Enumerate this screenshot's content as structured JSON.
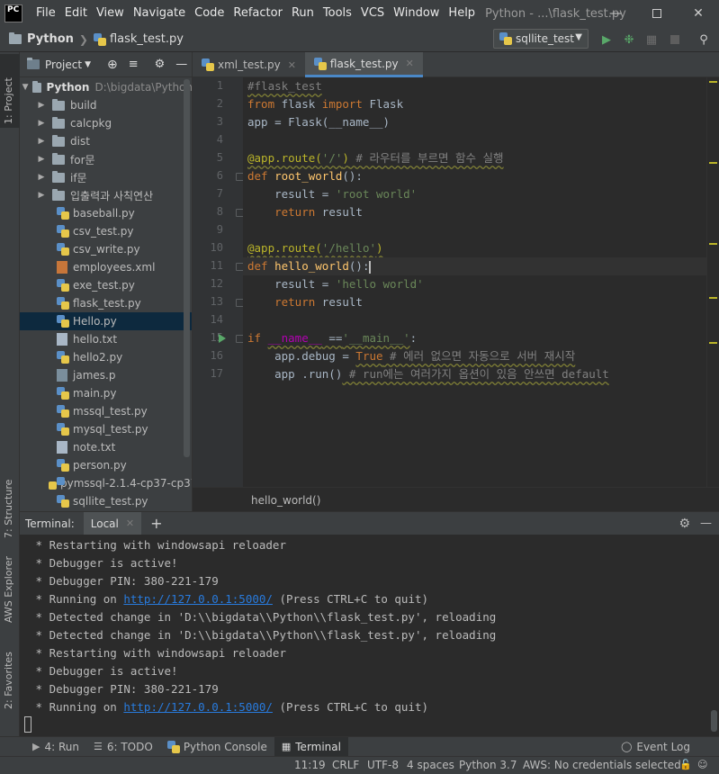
{
  "window": {
    "logo": "PC",
    "title": "Python - ...\\flask_test.py",
    "menu": [
      "File",
      "Edit",
      "View",
      "Navigate",
      "Code",
      "Refactor",
      "Run",
      "Tools",
      "VCS",
      "Window",
      "Help"
    ]
  },
  "navbar": {
    "project": "Python",
    "file": "flask_test.py",
    "run_config": "sqllite_test"
  },
  "left_stripe": {
    "project": "1: Project",
    "structure": "7: Structure",
    "aws": "AWS Explorer",
    "favorites": "2: Favorites"
  },
  "project_panel": {
    "title": "Project",
    "root": {
      "name": "Python",
      "path": "D:\\bigdata\\Python"
    },
    "folders": [
      "build",
      "calcpkg",
      "dist",
      "for문",
      "if문",
      "입출력과 사칙연산"
    ],
    "files": [
      {
        "name": "baseball.py",
        "type": "py"
      },
      {
        "name": "csv_test.py",
        "type": "py"
      },
      {
        "name": "csv_write.py",
        "type": "py"
      },
      {
        "name": "employees.xml",
        "type": "xml"
      },
      {
        "name": "exe_test.py",
        "type": "py"
      },
      {
        "name": "flask_test.py",
        "type": "py"
      },
      {
        "name": "Hello.py",
        "type": "py"
      },
      {
        "name": "hello.txt",
        "type": "txt"
      },
      {
        "name": "hello2.py",
        "type": "py"
      },
      {
        "name": "james.p",
        "type": "gen"
      },
      {
        "name": "main.py",
        "type": "py"
      },
      {
        "name": "mssql_test.py",
        "type": "py"
      },
      {
        "name": "mysql_test.py",
        "type": "py"
      },
      {
        "name": "note.txt",
        "type": "txt"
      },
      {
        "name": "person.py",
        "type": "py"
      },
      {
        "name": "pymssql-2.1.4-cp37-cp37",
        "type": "py"
      },
      {
        "name": "sqllite_test.py",
        "type": "py"
      }
    ],
    "selected": "Hello.py"
  },
  "editor": {
    "tabs": [
      {
        "label": "xml_test.py",
        "active": false
      },
      {
        "label": "flask_test.py",
        "active": true
      }
    ],
    "line_numbers": [
      "1",
      "2",
      "3",
      "4",
      "5",
      "6",
      "7",
      "8",
      "9",
      "10",
      "11",
      "12",
      "13",
      "14",
      "15",
      "16",
      "17"
    ],
    "code": {
      "l1": "#flask_test",
      "l2_kw": "from",
      "l2_mod": " flask ",
      "l2_kw2": "import",
      "l2_name": " Flask",
      "l3": "app = Flask(__name__)",
      "l5_deco": "@app.route(",
      "l5_str": "'/'",
      "l5_close": ")",
      "l5_cmt": " # 라우터를 부르면 함수 실행",
      "l6_kw": "def ",
      "l6_fn": "root_world",
      "l6_rest": "():",
      "l7_a": "    result = ",
      "l7_str": "'root world'",
      "l8_kw": "    return",
      "l8_rest": " result",
      "l10_deco": "@app.route(",
      "l10_str": "'/hello'",
      "l10_close": ")",
      "l11_kw": "def ",
      "l11_fn": "hello_world",
      "l11_rest": "():",
      "l12_a": "    result = ",
      "l12_str": "'hello world'",
      "l13_kw": "    return",
      "l13_rest": " result",
      "l15_kw": "if ",
      "l15_name": "__name__",
      "l15_op": " ==",
      "l15_str": "'__main__'",
      "l15_colon": ":",
      "l16_a": "    app.debug = ",
      "l16_bool": "True",
      "l16_cmt": " # 에러 없으면 자동으로 서버 재시작",
      "l17_a": "    app .run()",
      "l17_cmt": " # run에는 여러가지 옵션이 있음 안쓰면 default"
    },
    "breadcrumb": "hello_world()"
  },
  "terminal": {
    "label": "Terminal:",
    "tab": "Local",
    "lines": [
      " * Restarting with windowsapi reloader",
      " * Debugger is active!",
      " * Debugger PIN: 380-221-179",
      " * Detected change in 'D:\\\\bigdata\\\\Python\\\\flask_test.py', reloading",
      " * Detected change in 'D:\\\\bigdata\\\\Python\\\\flask_test.py', reloading",
      " * Restarting with windowsapi reloader",
      " * Debugger is active!",
      " * Debugger PIN: 380-221-179"
    ],
    "running_prefix": " * Running on ",
    "running_url": "http://127.0.0.1:5000/",
    "running_suffix": " (Press CTRL+C to quit)"
  },
  "bottom_toolbar": {
    "run": "4: Run",
    "todo": "6: TODO",
    "console": "Python Console",
    "terminal": "Terminal",
    "event_log": "Event Log"
  },
  "statusbar": {
    "position": "11:19",
    "line_sep": "CRLF",
    "encoding": "UTF-8",
    "indent": "4 spaces",
    "interpreter": "Python 3.7",
    "aws": "AWS: No credentials selected"
  },
  "colors": {
    "accent": "#4a88c7",
    "selection": "#0d293e",
    "link": "#287bde",
    "run_green": "#59a869"
  }
}
